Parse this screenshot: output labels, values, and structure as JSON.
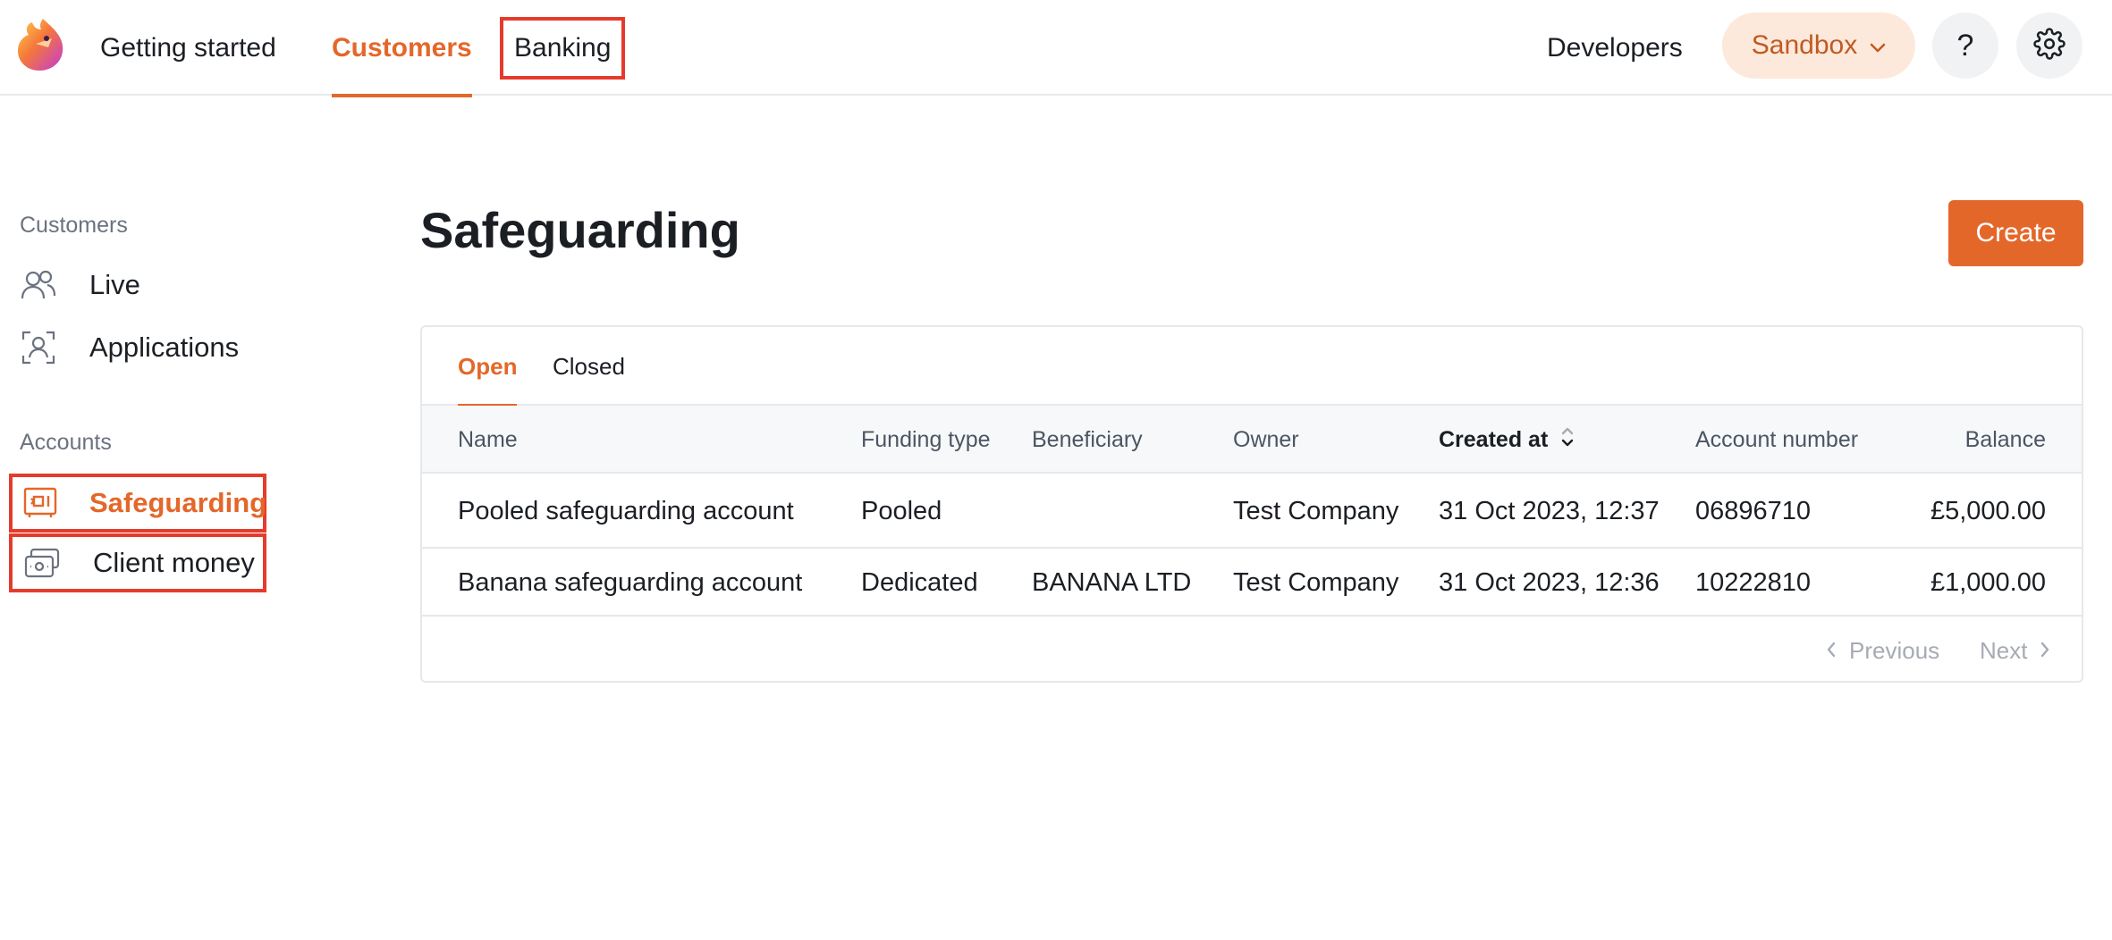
{
  "nav": {
    "getting_started": "Getting started",
    "customers": "Customers",
    "banking": "Banking",
    "developers": "Developers",
    "environment": "Sandbox",
    "help_label": "?"
  },
  "sidebar": {
    "customers_heading": "Customers",
    "customers_items": [
      {
        "label": "Live",
        "icon": "users-icon"
      },
      {
        "label": "Applications",
        "icon": "face-scan-icon"
      }
    ],
    "accounts_heading": "Accounts",
    "accounts_items": [
      {
        "label": "Safeguarding",
        "icon": "vault-icon",
        "active": true
      },
      {
        "label": "Client money",
        "icon": "cash-icon",
        "active": false
      }
    ]
  },
  "main": {
    "title": "Safeguarding",
    "create_label": "Create",
    "tabs": [
      {
        "label": "Open",
        "active": true
      },
      {
        "label": "Closed",
        "active": false
      }
    ],
    "columns": [
      "Name",
      "Funding type",
      "Beneficiary",
      "Owner",
      "Created at",
      "Account number",
      "Balance"
    ],
    "sorted_column": "Created at",
    "rows": [
      {
        "name": "Pooled safeguarding account",
        "funding_type": "Pooled",
        "beneficiary": "",
        "owner": "Test Company",
        "created_at": "31 Oct 2023, 12:37",
        "account_number": "06896710",
        "balance": "£5,000.00"
      },
      {
        "name": "Banana safeguarding account",
        "funding_type": "Dedicated",
        "beneficiary": "BANANA LTD",
        "owner": "Test Company",
        "created_at": "31 Oct 2023, 12:36",
        "account_number": "10222810",
        "balance": "£1,000.00"
      }
    ],
    "pagination": {
      "previous": "Previous",
      "next": "Next"
    }
  },
  "colors": {
    "accent": "#e4672a",
    "highlight_box": "#e53b2c",
    "sandbox_bg": "#fde9dc"
  }
}
